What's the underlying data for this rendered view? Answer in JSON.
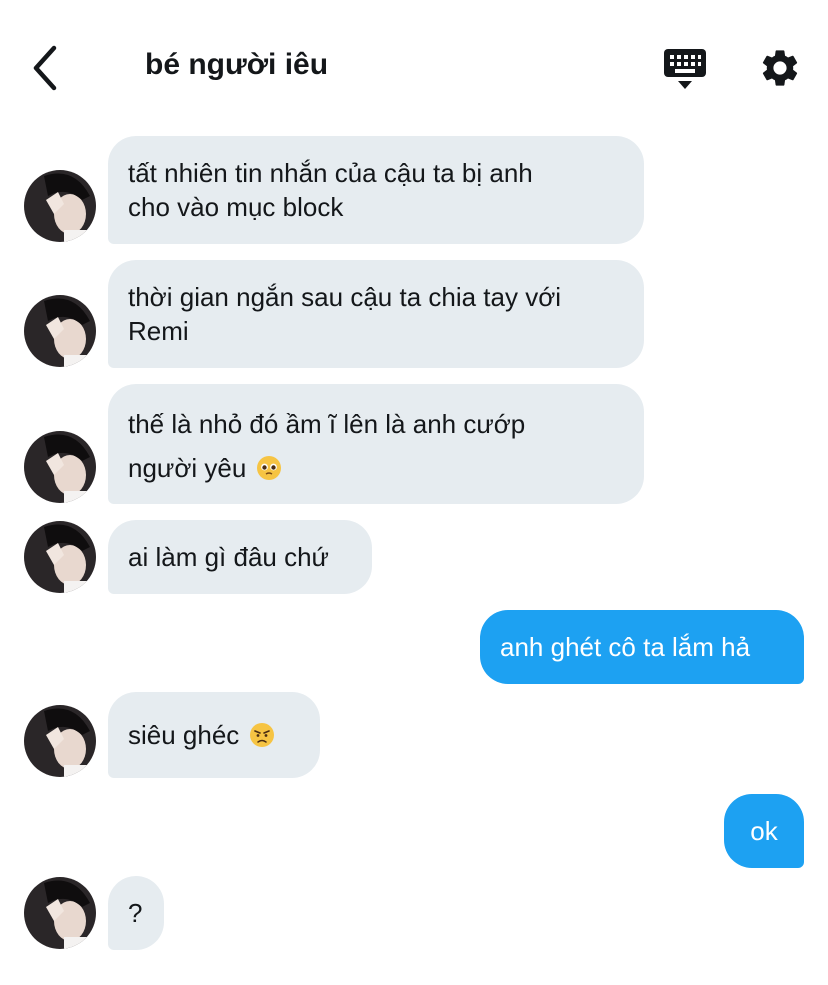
{
  "header": {
    "title": "bé người iêu",
    "back_icon": "chevron-left-icon",
    "keyboard_icon": "keyboard-icon",
    "settings_icon": "gear-icon"
  },
  "colors": {
    "incoming_bubble": "#e6ecf0",
    "outgoing_bubble": "#1da1f2",
    "text": "#14171a"
  },
  "messages": [
    {
      "from": "them",
      "lines": [
        "tất nhiên tin nhắn của cậu ta bị anh",
        "cho vào mục block"
      ]
    },
    {
      "from": "them",
      "lines": [
        "thời gian ngắn sau cậu ta chia tay với",
        "Remi"
      ]
    },
    {
      "from": "them",
      "lines": [
        "thế là nhỏ đó ầm ĩ lên là anh cướp",
        "người yêu"
      ],
      "emoji": "pleading-face-emoji"
    },
    {
      "from": "them",
      "lines": [
        "ai làm gì đâu chứ"
      ]
    },
    {
      "from": "me",
      "lines": [
        "anh ghét cô ta lắm hả"
      ]
    },
    {
      "from": "them",
      "lines": [
        "siêu ghéc"
      ],
      "emoji": "angry-face-emoji"
    },
    {
      "from": "me",
      "lines": [
        "ok"
      ]
    },
    {
      "from": "them",
      "lines": [
        "?"
      ]
    }
  ]
}
